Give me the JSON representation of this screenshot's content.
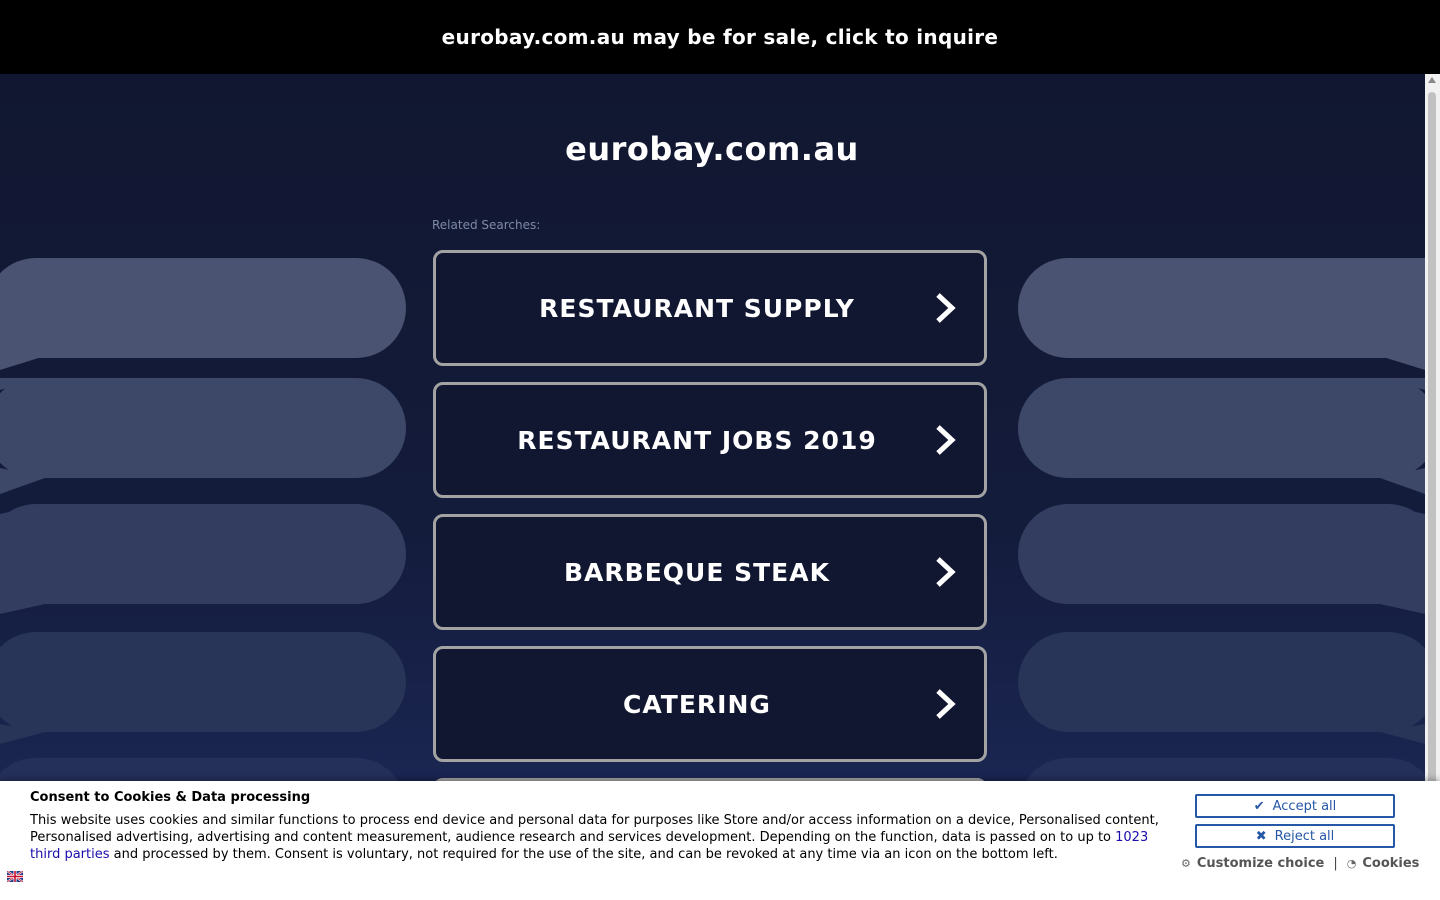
{
  "sale_banner": "eurobay.com.au may be for sale, click to inquire",
  "domain_title": "eurobay.com.au",
  "related_label": "Related Searches:",
  "related": [
    {
      "label": "RESTAURANT SUPPLY"
    },
    {
      "label": "RESTAURANT JOBS 2019"
    },
    {
      "label": "BARBEQUE STEAK"
    },
    {
      "label": "CATERING"
    }
  ],
  "consent": {
    "title": "Consent to Cookies & Data processing",
    "text_before": "This website uses cookies and similar functions to process end device and personal data for purposes like Store and/or access information on a device, Personalised content, Personalised advertising, advertising and content measurement, audience research and services development. Depending on the function, data is passed on to up to ",
    "link": "1023 third parties",
    "text_after": " and processed by them. Consent is voluntary, not required for the use of the site, and can be revoked at any time via an icon on the bottom left.",
    "accept": "Accept all",
    "reject": "Reject all",
    "customize": "Customize choice",
    "separator": "|",
    "cookies": "Cookies"
  },
  "colors": {
    "background": "#111730",
    "button_border": "#a3a3a3",
    "consent_accent": "#2557a7"
  },
  "icons": {
    "chevron": "chevron-right-icon",
    "check": "check-icon",
    "x": "close-icon",
    "gear": "gear-icon",
    "cookie": "cookie-icon",
    "flag": "uk-flag-icon"
  }
}
